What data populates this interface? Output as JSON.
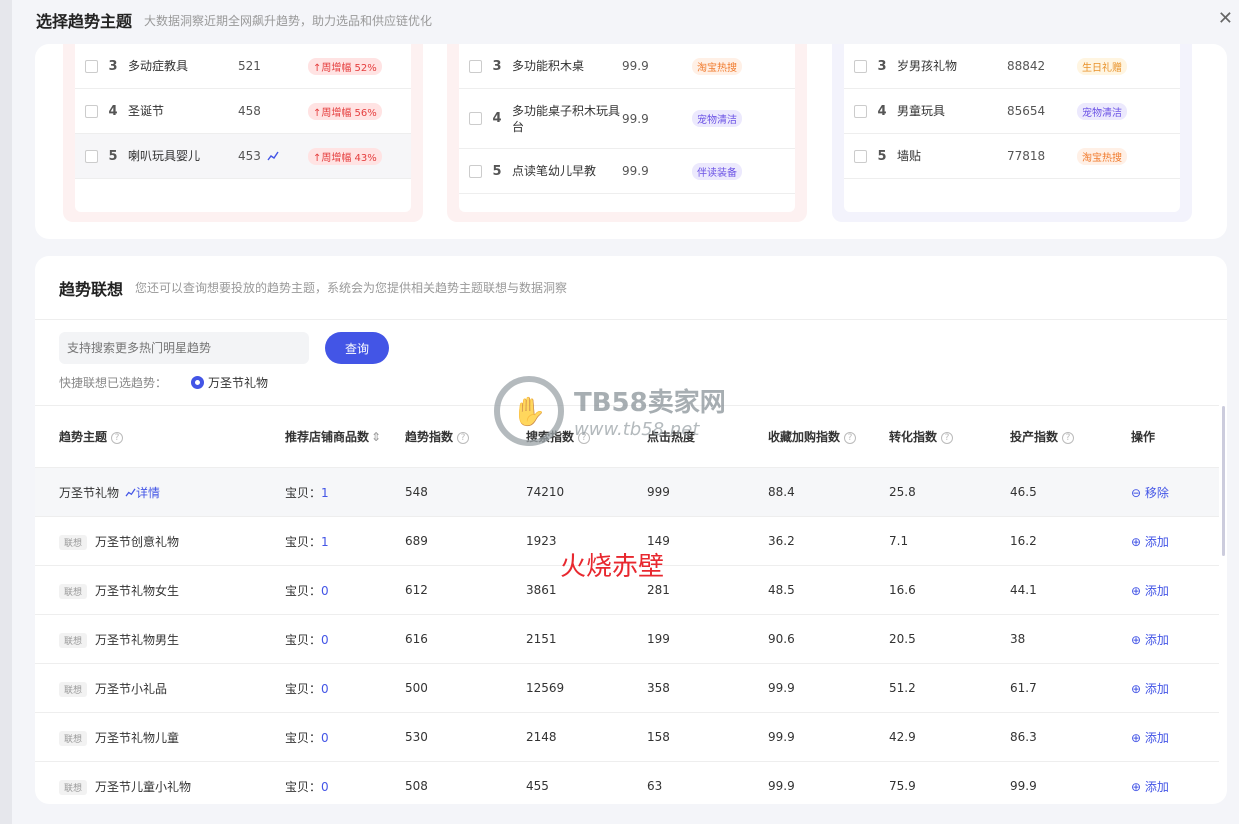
{
  "header": {
    "title": "选择趋势主题",
    "subtitle": "大数据洞察近期全网飙升趋势，助力选品和供应链优化",
    "close": "✕"
  },
  "top_lists": [
    {
      "rows": [
        {
          "rank": "3",
          "name": "多动症教具",
          "value": "521",
          "tag": "↑周增幅 52%",
          "tag_color": "red",
          "chart": false
        },
        {
          "rank": "4",
          "name": "圣诞节",
          "value": "458",
          "tag": "↑周增幅 56%",
          "tag_color": "red",
          "chart": false
        },
        {
          "rank": "5",
          "name": "喇叭玩具婴儿",
          "value": "453",
          "tag": "↑周增幅 43%",
          "tag_color": "red",
          "chart": true
        }
      ]
    },
    {
      "rows": [
        {
          "rank": "3",
          "name": "多功能积木桌",
          "value": "99.9",
          "tag": "淘宝热搜",
          "tag_color": "orange"
        },
        {
          "rank": "4",
          "name": "多功能桌子积木玩具台",
          "value": "99.9",
          "tag": "宠物清洁",
          "tag_color": "purple"
        },
        {
          "rank": "5",
          "name": "点读笔幼儿早教",
          "value": "99.9",
          "tag": "伴读装备",
          "tag_color": "purple"
        }
      ]
    },
    {
      "rows": [
        {
          "rank": "3",
          "name": "岁男孩礼物",
          "value": "88842",
          "tag": "生日礼赠",
          "tag_color": "yellow"
        },
        {
          "rank": "4",
          "name": "男童玩具",
          "value": "85654",
          "tag": "宠物清洁",
          "tag_color": "purple"
        },
        {
          "rank": "5",
          "name": "墙贴",
          "value": "77818",
          "tag": "淘宝热搜",
          "tag_color": "orange"
        }
      ]
    }
  ],
  "association": {
    "title": "趋势联想",
    "subtitle": "您还可以查询想要投放的趋势主题，系统会为您提供相关趋势主题联想与数据洞察",
    "search_placeholder": "支持搜索更多热门明星趋势",
    "search_button": "查询",
    "quick_label": "快捷联想已选趋势：",
    "quick_selected": "万圣节礼物"
  },
  "table": {
    "headers": [
      "趋势主题",
      "推荐店铺商品数",
      "趋势指数",
      "搜索指数",
      "点击热度",
      "收藏加购指数",
      "转化指数",
      "投产指数",
      "操作"
    ],
    "rows": [
      {
        "lx": "",
        "name": "万圣节礼物",
        "detail": "详情",
        "items_label": "宝贝：",
        "items": "1",
        "trend": "548",
        "search": "74210",
        "click": "999",
        "fav": "88.4",
        "conv": "25.8",
        "roi": "46.5",
        "action": "⊖ 移除"
      },
      {
        "lx": "联想",
        "name": "万圣节创意礼物",
        "detail": "",
        "items_label": "宝贝：",
        "items": "1",
        "trend": "689",
        "search": "1923",
        "click": "149",
        "fav": "36.2",
        "conv": "7.1",
        "roi": "16.2",
        "action": "⊕ 添加"
      },
      {
        "lx": "联想",
        "name": "万圣节礼物女生",
        "detail": "",
        "items_label": "宝贝：",
        "items": "0",
        "trend": "612",
        "search": "3861",
        "click": "281",
        "fav": "48.5",
        "conv": "16.6",
        "roi": "44.1",
        "action": "⊕ 添加"
      },
      {
        "lx": "联想",
        "name": "万圣节礼物男生",
        "detail": "",
        "items_label": "宝贝：",
        "items": "0",
        "trend": "616",
        "search": "2151",
        "click": "199",
        "fav": "90.6",
        "conv": "20.5",
        "roi": "38",
        "action": "⊕ 添加"
      },
      {
        "lx": "联想",
        "name": "万圣节小礼品",
        "detail": "",
        "items_label": "宝贝：",
        "items": "0",
        "trend": "500",
        "search": "12569",
        "click": "358",
        "fav": "99.9",
        "conv": "51.2",
        "roi": "61.7",
        "action": "⊕ 添加"
      },
      {
        "lx": "联想",
        "name": "万圣节礼物儿童",
        "detail": "",
        "items_label": "宝贝：",
        "items": "0",
        "trend": "530",
        "search": "2148",
        "click": "158",
        "fav": "99.9",
        "conv": "42.9",
        "roi": "86.3",
        "action": "⊕ 添加"
      },
      {
        "lx": "联想",
        "name": "万圣节儿童小礼物",
        "detail": "",
        "items_label": "宝贝：",
        "items": "0",
        "trend": "508",
        "search": "455",
        "click": "63",
        "fav": "99.9",
        "conv": "75.9",
        "roi": "99.9",
        "action": "⊕ 添加"
      }
    ]
  },
  "watermarks": {
    "site": "TB58卖家网",
    "url": "www.tb58.net",
    "red": "火烧赤壁"
  }
}
